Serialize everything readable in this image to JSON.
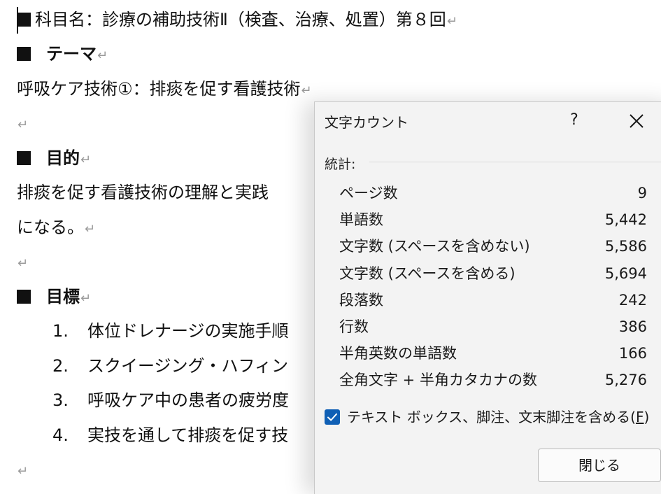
{
  "document": {
    "title_line": "科目名：診療の補助技術Ⅱ（検査、治療、処置）第８回",
    "theme_heading": "テーマ",
    "theme_text": "呼吸ケア技術①：排痰を促す看護技術",
    "purpose_heading": "目的",
    "purpose_text_1": "排痰を促す看護技術の理解と実践",
    "purpose_text_2": "になる。",
    "goals_heading": "目標",
    "goals": [
      {
        "num": "1.",
        "text": "体位ドレナージの実施手順"
      },
      {
        "num": "2.",
        "text": "スクイージング・ハフィン"
      },
      {
        "num": "3.",
        "text": "呼吸ケア中の患者の疲労度"
      },
      {
        "num": "4.",
        "text": "実技を通して排痰を促す技"
      }
    ],
    "return_mark": "↵"
  },
  "dialog": {
    "title": "文字カウント",
    "help_label": "?",
    "close_icon": "close-icon",
    "group_label": "統計:",
    "stats": [
      {
        "label": "ページ数",
        "value": "9"
      },
      {
        "label": "単語数",
        "value": "5,442"
      },
      {
        "label": "文字数 (スペースを含めない)",
        "value": "5,586"
      },
      {
        "label": "文字数 (スペースを含める)",
        "value": "5,694"
      },
      {
        "label": "段落数",
        "value": "242"
      },
      {
        "label": "行数",
        "value": "386"
      },
      {
        "label": "半角英数の単語数",
        "value": "166"
      },
      {
        "label": "全角文字 + 半角カタカナの数",
        "value": "5,276"
      }
    ],
    "checkbox_label": "テキスト ボックス、脚注、文末脚注を含める(",
    "checkbox_accel": "F",
    "checkbox_label_end": ")",
    "checkbox_checked": true,
    "close_button": "閉じる",
    "accent_color": "#0f5fb5"
  }
}
